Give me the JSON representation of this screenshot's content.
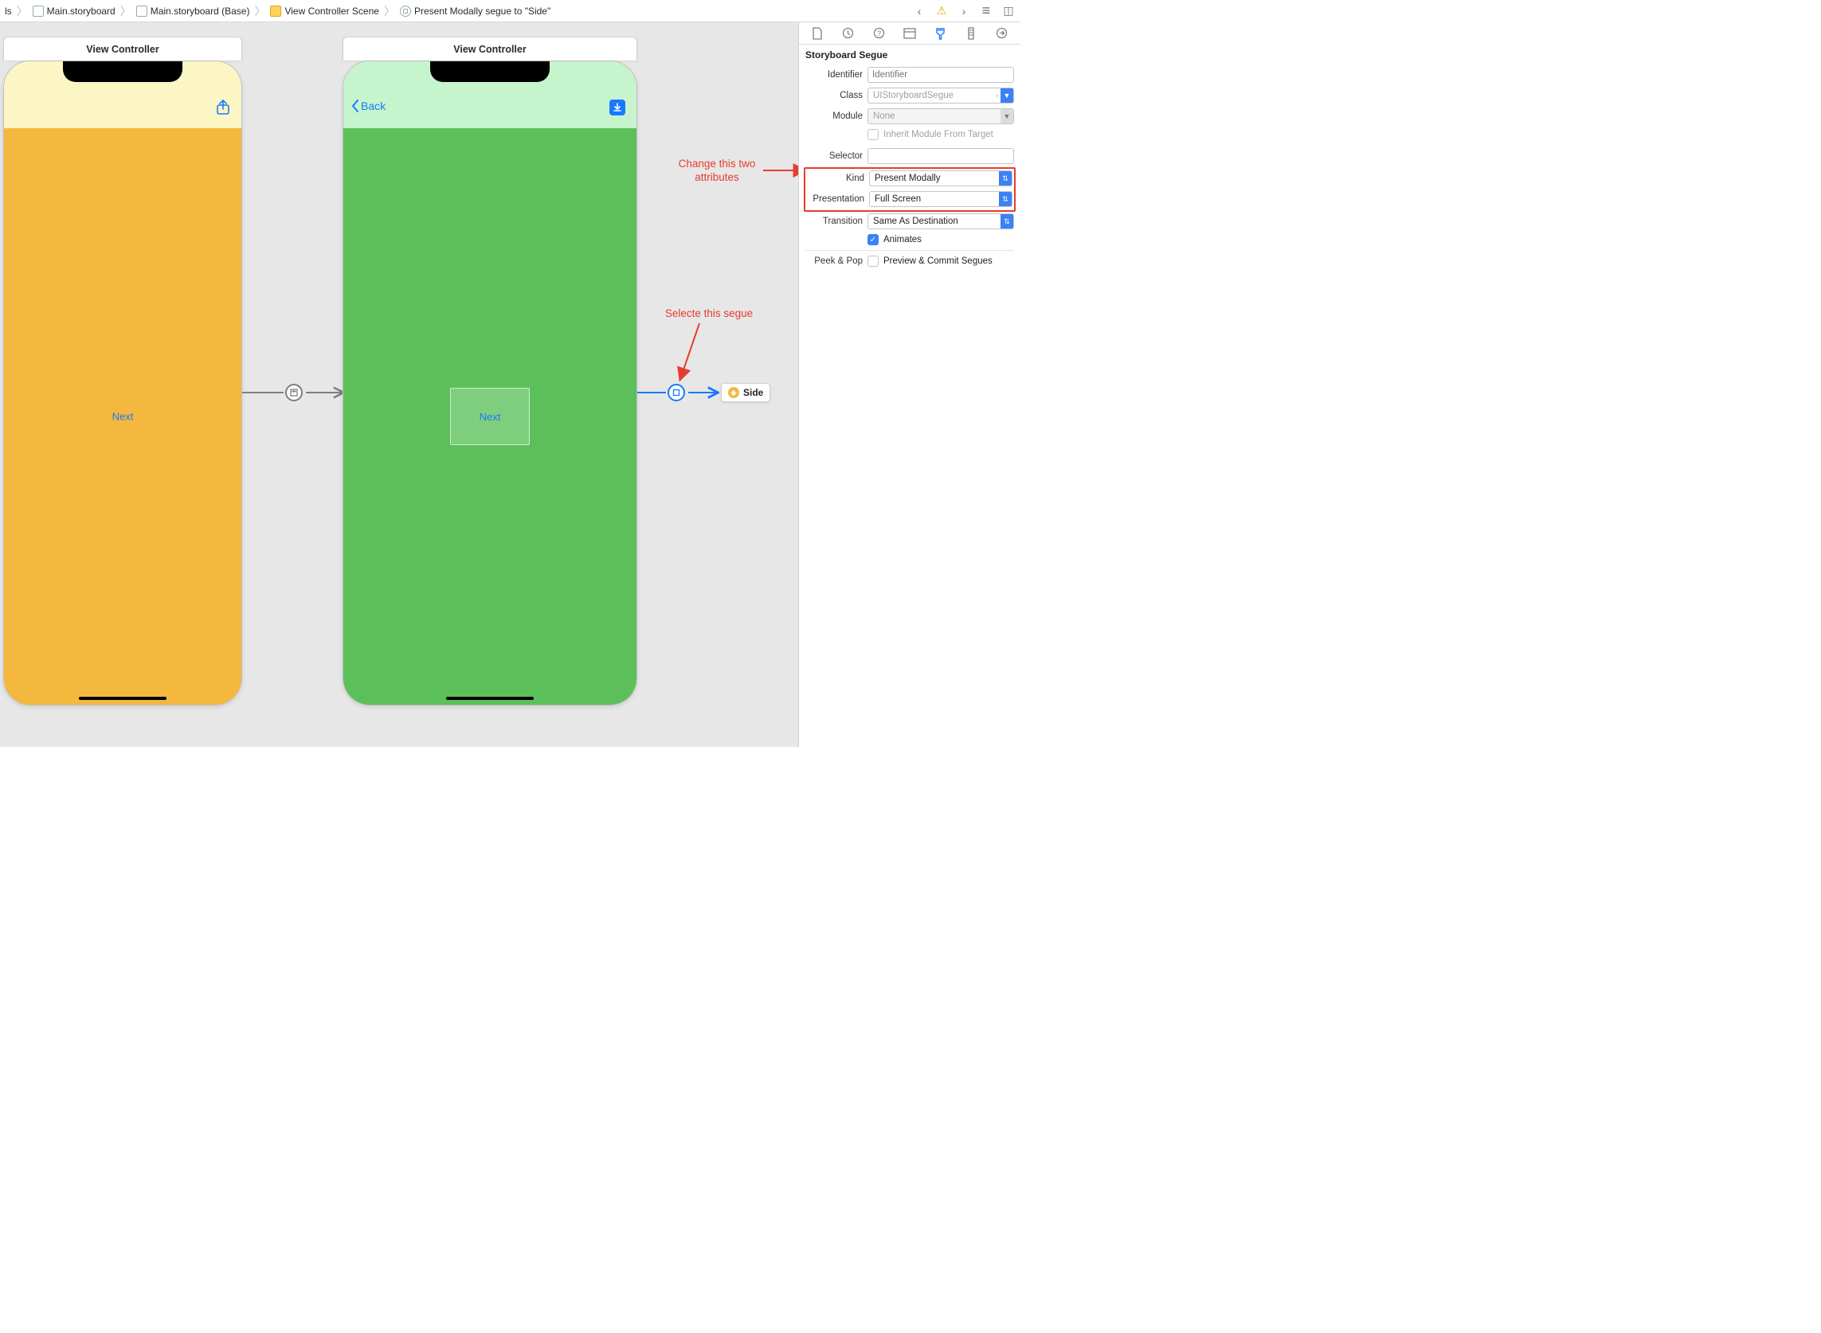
{
  "breadcrumbs": {
    "b0": "ls",
    "b1": "Main.storyboard",
    "b2": "Main.storyboard (Base)",
    "b3": "View Controller Scene",
    "b4": "Present Modally segue to \"Side\""
  },
  "canvas": {
    "vc1_title": "View Controller",
    "vc2_title": "View Controller",
    "vc1_next": "Next",
    "vc2_back": "Back",
    "vc2_next": "Next",
    "ref_label": "Side"
  },
  "annotations": {
    "change_attrs": "Change this two attributes",
    "select_segue": "Selecte this segue"
  },
  "inspector": {
    "title": "Storyboard Segue",
    "labels": {
      "identifier": "Identifier",
      "klass": "Class",
      "module": "Module",
      "inherit": "Inherit Module From Target",
      "selector": "Selector",
      "kind": "Kind",
      "presentation": "Presentation",
      "transition": "Transition",
      "animates": "Animates",
      "peek": "Peek & Pop",
      "preview": "Preview & Commit Segues"
    },
    "values": {
      "identifier_value": "",
      "identifier_placeholder": "Identifier",
      "klass": "UIStoryboardSegue",
      "module": "None",
      "selector": "",
      "kind": "Present Modally",
      "presentation": "Full Screen",
      "transition": "Same As Destination",
      "animates_checked": true,
      "inherit_checked": false,
      "preview_checked": false
    }
  },
  "icon_glyphs": {
    "chev_left": "‹",
    "chev_right": "›",
    "warn": "⚠︎",
    "lines": "≡",
    "panel": "◫",
    "up": "▲",
    "down": "▼"
  }
}
